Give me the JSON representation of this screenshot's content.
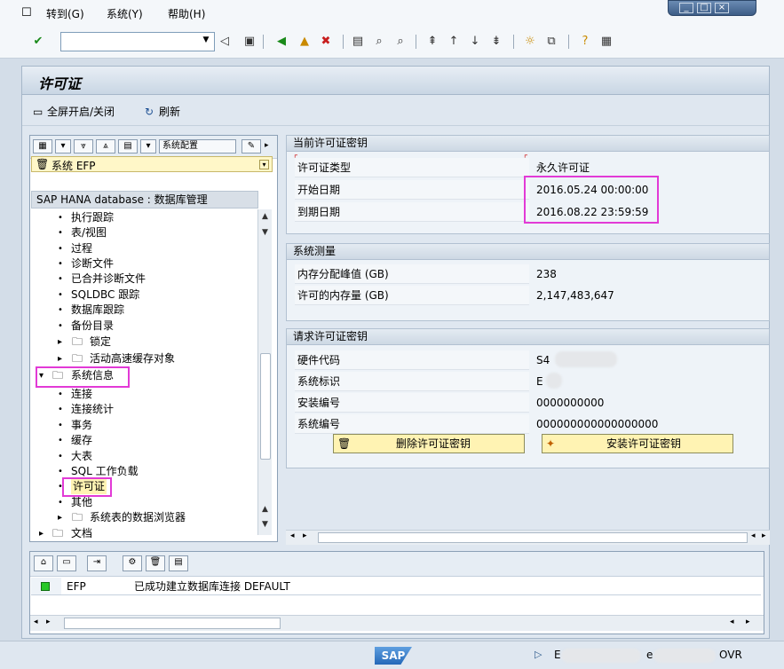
{
  "menubar": {
    "items": [
      "转到(G)",
      "系统(Y)",
      "帮助(H)"
    ]
  },
  "toolbar": {
    "command_value": ""
  },
  "screen": {
    "title": "许可证"
  },
  "app_toolbar": {
    "fullscreen_label": "全屏开启/关闭",
    "refresh_label": "刷新"
  },
  "left_panel": {
    "toolbar_label": "系统配置",
    "system_selector": "系统 EFP",
    "tree_header": "SAP HANA database : 数据库管理",
    "tree_items": [
      {
        "label": "执行跟踪",
        "type": "leaf"
      },
      {
        "label": "表/视图",
        "type": "leaf"
      },
      {
        "label": "过程",
        "type": "leaf"
      },
      {
        "label": "诊断文件",
        "type": "leaf"
      },
      {
        "label": "已合并诊断文件",
        "type": "leaf"
      },
      {
        "label": "SQLDBC 跟踪",
        "type": "leaf"
      },
      {
        "label": "数据库跟踪",
        "type": "leaf"
      },
      {
        "label": "备份目录",
        "type": "leaf"
      },
      {
        "label": "锁定",
        "type": "folder"
      },
      {
        "label": "活动高速缓存对象",
        "type": "folder"
      },
      {
        "label": "系统信息",
        "type": "folder-open"
      },
      {
        "label": "连接",
        "type": "leaf"
      },
      {
        "label": "连接统计",
        "type": "leaf"
      },
      {
        "label": "事务",
        "type": "leaf"
      },
      {
        "label": "缓存",
        "type": "leaf"
      },
      {
        "label": "大表",
        "type": "leaf"
      },
      {
        "label": "SQL 工作负载",
        "type": "leaf"
      },
      {
        "label": "许可证",
        "type": "leaf-selected"
      },
      {
        "label": "其他",
        "type": "leaf"
      },
      {
        "label": "系统表的数据浏览器",
        "type": "folder"
      },
      {
        "label": "文档",
        "type": "folder"
      }
    ]
  },
  "license_key": {
    "header": "当前许可证密钥",
    "rows": [
      {
        "label": "许可证类型",
        "value": "永久许可证"
      },
      {
        "label": "开始日期",
        "value": "2016.05.24 00:00:00"
      },
      {
        "label": "到期日期",
        "value": "2016.08.22 23:59:59"
      }
    ]
  },
  "measurement": {
    "header": "系统测量",
    "rows": [
      {
        "label": "内存分配峰值 (GB)",
        "value": "238"
      },
      {
        "label": "许可的内存量 (GB)",
        "value": "2,147,483,647"
      }
    ]
  },
  "request_key": {
    "header": "请求许可证密钥",
    "rows": [
      {
        "label": "硬件代码",
        "value": "S4"
      },
      {
        "label": "系统标识",
        "value": "E"
      },
      {
        "label": "安装编号",
        "value": "0000000000"
      },
      {
        "label": "系统编号",
        "value": "000000000000000000"
      }
    ],
    "delete_button": "删除许可证密钥",
    "install_button": "安装许可证密钥"
  },
  "messages": [
    {
      "status": "success",
      "system": "EFP",
      "text": "已成功建立数据库连接 DEFAULT"
    }
  ],
  "statusbar": {
    "logo": "SAP",
    "system_fragment": "E",
    "client_fragment": "e",
    "mode": "OVR"
  },
  "colors": {
    "highlight": "#e23ad6",
    "button_yellow": "#fff3b3",
    "success_green": "#28c828"
  }
}
